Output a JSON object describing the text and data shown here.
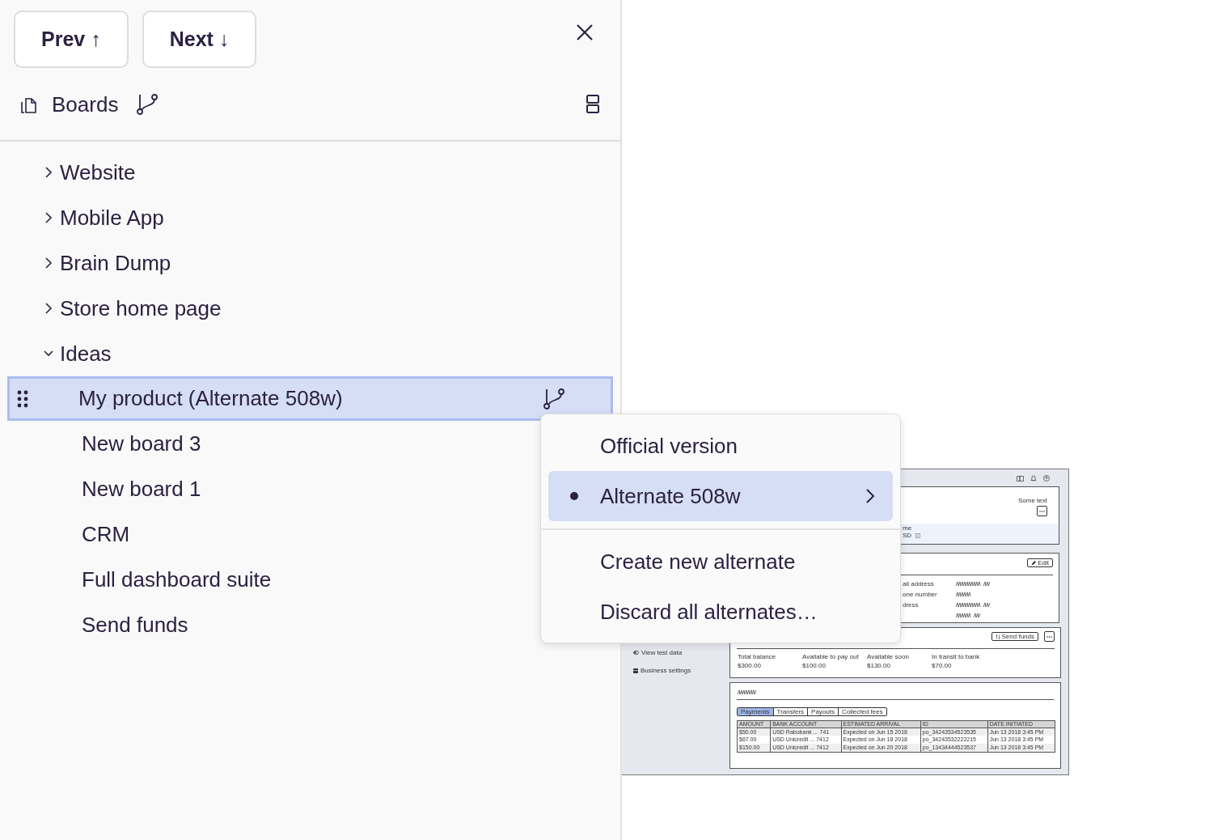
{
  "nav_buttons": [
    {
      "label": "Prev ↑"
    },
    {
      "label": "Next ↓"
    }
  ],
  "header": {
    "title": "Boards"
  },
  "tree": [
    {
      "label": "Website",
      "expanded": false
    },
    {
      "label": "Mobile App",
      "expanded": false
    },
    {
      "label": "Brain Dump",
      "expanded": false
    },
    {
      "label": "Store home page",
      "expanded": false
    },
    {
      "label": "Ideas",
      "expanded": true,
      "children": [
        {
          "label": "My product (Alternate 508w)",
          "selected": true
        },
        {
          "label": "New board 3",
          "selected": false
        },
        {
          "label": "New board 1",
          "selected": false
        },
        {
          "label": "CRM",
          "selected": false
        },
        {
          "label": "Full dashboard suite",
          "selected": false
        },
        {
          "label": "Send funds",
          "selected": false
        }
      ]
    }
  ],
  "menu": {
    "versions": [
      {
        "label": "Official version",
        "selected": false,
        "submenu": false
      },
      {
        "label": "Alternate 508w",
        "selected": true,
        "submenu": true
      }
    ],
    "actions": [
      {
        "label": "Create new alternate"
      },
      {
        "label": "Discard all alternates…"
      }
    ]
  },
  "preview": {
    "sidebar": [
      {
        "label": "View test data",
        "kind": "toggle"
      },
      {
        "label": "Business settings",
        "kind": "store"
      }
    ],
    "profile_card": {
      "note": "Some text",
      "field_label": "me",
      "field_value": "SD"
    },
    "details_card": {
      "edit_button": "Edit",
      "labels": [
        "ail address",
        "one number",
        "dress"
      ]
    },
    "balance_card": {
      "button": "Send funds",
      "stats": [
        {
          "label": "Total balance",
          "value": "$300.00"
        },
        {
          "label": "Available to pay out",
          "value": "$100.00"
        },
        {
          "label": "Available soon",
          "value": "$130.00"
        },
        {
          "label": "In transit to bank",
          "value": "$70.00"
        }
      ]
    },
    "payments_card": {
      "tabs": [
        {
          "label": "Payments",
          "selected": true
        },
        {
          "label": "Transfers",
          "selected": false
        },
        {
          "label": "Payouts",
          "selected": false
        },
        {
          "label": "Collected fees",
          "selected": false
        }
      ],
      "columns": [
        "AMOUNT",
        "BANK ACCOUNT",
        "ESTIMATED ARRIVAL",
        "ID",
        "DATE INITIATED"
      ],
      "rows": [
        [
          "$50.00",
          "USD Rabobank ... 741",
          "Expected on Jun 15 2018",
          "po_34243534523535",
          "Jun 13 2018 3:45 PM"
        ],
        [
          "$67.00",
          "USD Unicredit ... 7412",
          "Expected on Jun 18 2018",
          "po_34243532222215",
          "Jun 13 2018 3:45 PM"
        ],
        [
          "$150.00",
          "USD Unicredit ... 7412",
          "Expected on Jun 20 2018",
          "po_13434444523537",
          "Jun 13 2018 3:45 PM"
        ]
      ]
    }
  }
}
